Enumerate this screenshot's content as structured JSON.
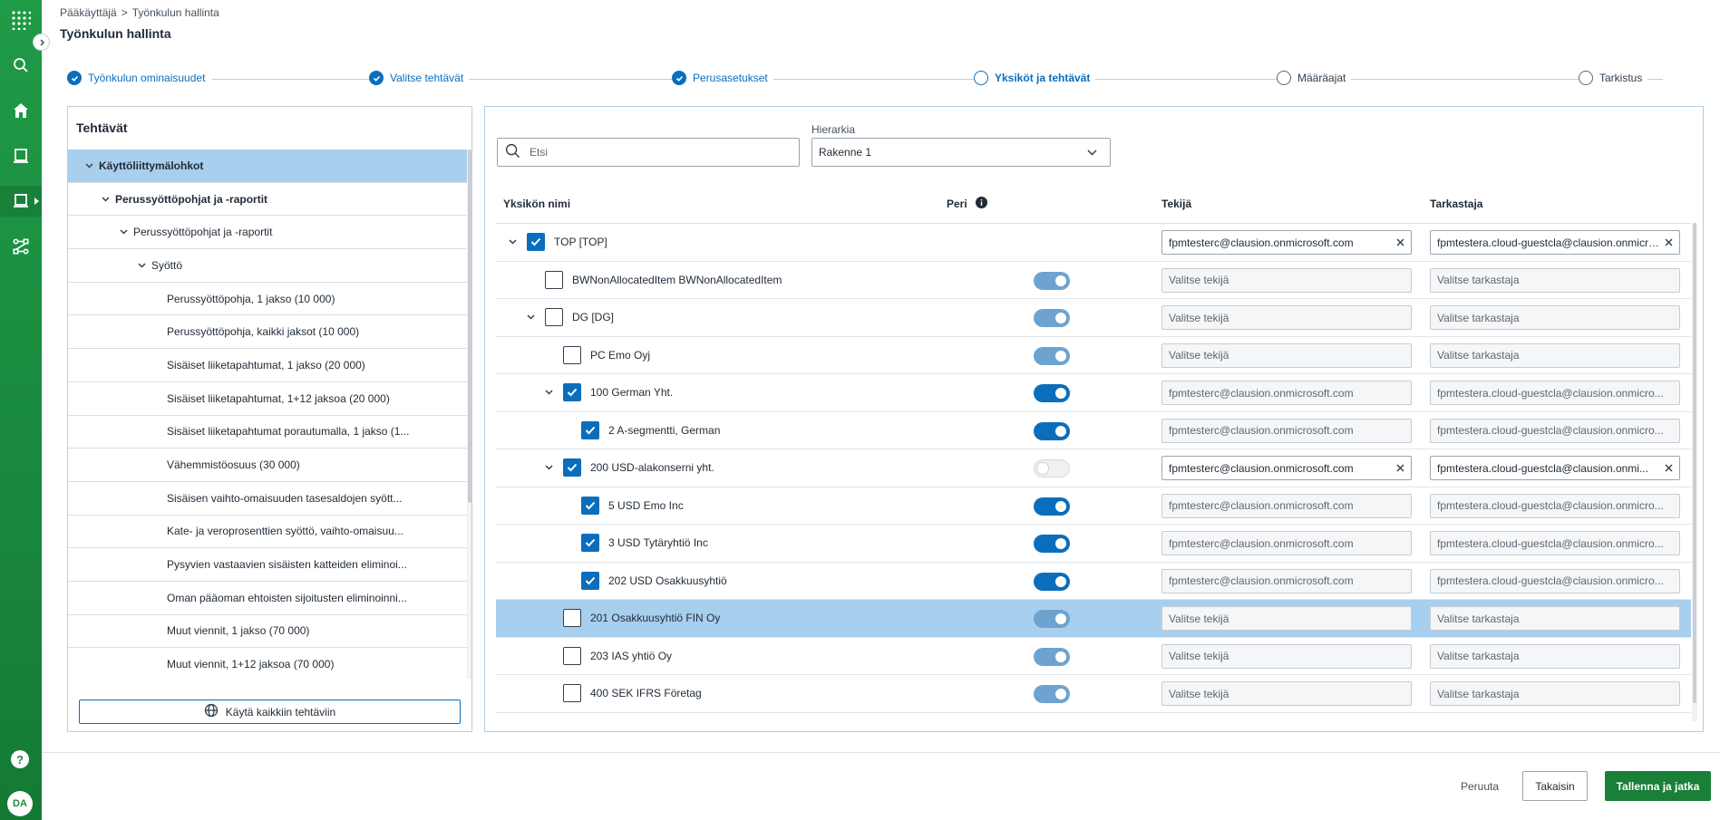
{
  "breadcrumb": {
    "root": "Pääkäyttäjä",
    "separator": ">",
    "current": "Työnkulun hallinta"
  },
  "page_title": "Työnkulun hallinta",
  "steps": [
    {
      "label": "Työnkulun ominaisuudet",
      "state": "done"
    },
    {
      "label": "Valitse tehtävät",
      "state": "done"
    },
    {
      "label": "Perusasetukset",
      "state": "done"
    },
    {
      "label": "Yksiköt ja tehtävät",
      "state": "current"
    },
    {
      "label": "Määräajat",
      "state": "todo"
    },
    {
      "label": "Tarkistus",
      "state": "todo"
    }
  ],
  "tasks_panel": {
    "title": "Tehtävät",
    "items": [
      {
        "label": "Käyttöliittymälohkot",
        "level": 0,
        "expanded": true,
        "bold": true,
        "selected": true
      },
      {
        "label": "Perussyöttöpohjat ja -raportit",
        "level": 1,
        "expanded": true,
        "bold": true
      },
      {
        "label": "Perussyöttöpohjat ja -raportit",
        "level": 2,
        "expanded": true
      },
      {
        "label": "Syöttö",
        "level": 3,
        "expanded": true
      },
      {
        "label": "Perussyöttöpohja, 1 jakso (10 000)",
        "level": 4
      },
      {
        "label": "Perussyöttöpohja, kaikki jaksot (10 000)",
        "level": 4
      },
      {
        "label": "Sisäiset liiketapahtumat, 1 jakso (20 000)",
        "level": 4
      },
      {
        "label": "Sisäiset liiketapahtumat, 1+12 jaksoa (20 000)",
        "level": 4
      },
      {
        "label": "Sisäiset liiketapahtumat porautumalla, 1 jakso (1...",
        "level": 4
      },
      {
        "label": "Vähemmistöosuus (30 000)",
        "level": 4
      },
      {
        "label": "Sisäisen vaihto-omaisuuden tasesaldojen syött...",
        "level": 4
      },
      {
        "label": "Kate- ja veroprosenttien syöttö, vaihto-omaisuu...",
        "level": 4
      },
      {
        "label": "Pysyvien vastaavien sisäisten katteiden eliminoi...",
        "level": 4
      },
      {
        "label": "Oman pääoman ehtoisten sijoitusten eliminoinni...",
        "level": 4
      },
      {
        "label": "Muut viennit, 1 jakso (70 000)",
        "level": 4
      },
      {
        "label": "Muut viennit, 1+12 jaksoa (70 000)",
        "level": 4
      }
    ],
    "apply_all_label": "Käytä kaikkiin tehtäviin"
  },
  "units_panel": {
    "search_placeholder": "Etsi",
    "hierarchy_label": "Hierarkia",
    "hierarchy_value": "Rakenne 1",
    "columns": {
      "name": "Yksikön nimi",
      "peri": "Peri",
      "tekija": "Tekijä",
      "tarkastaja": "Tarkastaja"
    },
    "rows": [
      {
        "name": "TOP [TOP]",
        "level": 0,
        "expander": true,
        "checked": true,
        "toggle": "hidden",
        "tekija": "fpmtesterc@clausion.onmicrosoft.com",
        "tarkastaja": "fpmtestera.cloud-guestcla@clausion.onmicrosoft.com",
        "fields_active": true,
        "clearable": true
      },
      {
        "name": "BWNonAllocatedItem BWNonAllocatedItem",
        "level": 1,
        "expander": false,
        "checked": false,
        "toggle": "dim",
        "tekija": "Valitse tekijä",
        "tarkastaja": "Valitse tarkastaja"
      },
      {
        "name": "DG [DG]",
        "level": 1,
        "expander": true,
        "checked": false,
        "toggle": "dim",
        "tekija": "Valitse tekijä",
        "tarkastaja": "Valitse tarkastaja"
      },
      {
        "name": "PC Emo Oyj",
        "level": 2,
        "expander": false,
        "checked": false,
        "toggle": "dim",
        "tekija": "Valitse tekijä",
        "tarkastaja": "Valitse tarkastaja"
      },
      {
        "name": "100 German Yht.",
        "level": 2,
        "expander": true,
        "checked": true,
        "toggle": "on",
        "tekija": "fpmtesterc@clausion.onmicrosoft.com",
        "tarkastaja": "fpmtestera.cloud-guestcla@clausion.onmicro..."
      },
      {
        "name": "2 A-segmentti, German",
        "level": 3,
        "expander": false,
        "checked": true,
        "toggle": "on",
        "tekija": "fpmtesterc@clausion.onmicrosoft.com",
        "tarkastaja": "fpmtestera.cloud-guestcla@clausion.onmicro..."
      },
      {
        "name": "200 USD-alakonserni yht.",
        "level": 2,
        "expander": true,
        "checked": true,
        "toggle": "off",
        "tekija": "fpmtesterc@clausion.onmicrosoft.com",
        "tarkastaja": "fpmtestera.cloud-guestcla@clausion.onmi...",
        "fields_active": true,
        "clearable": true
      },
      {
        "name": "5 USD Emo Inc",
        "level": 3,
        "expander": false,
        "checked": true,
        "toggle": "on",
        "tekija": "fpmtesterc@clausion.onmicrosoft.com",
        "tarkastaja": "fpmtestera.cloud-guestcla@clausion.onmicro..."
      },
      {
        "name": "3 USD Tytäryhtiö Inc",
        "level": 3,
        "expander": false,
        "checked": true,
        "toggle": "on",
        "tekija": "fpmtesterc@clausion.onmicrosoft.com",
        "tarkastaja": "fpmtestera.cloud-guestcla@clausion.onmicro..."
      },
      {
        "name": "202 USD Osakkuusyhtiö",
        "level": 3,
        "expander": false,
        "checked": true,
        "toggle": "on",
        "tekija": "fpmtesterc@clausion.onmicrosoft.com",
        "tarkastaja": "fpmtestera.cloud-guestcla@clausion.onmicro..."
      },
      {
        "name": "201 Osakkuusyhtiö FIN Oy",
        "level": 2,
        "expander": false,
        "checked": false,
        "toggle": "dim",
        "tekija": "Valitse tekijä",
        "tarkastaja": "Valitse tarkastaja",
        "selected": true
      },
      {
        "name": "203 IAS yhtiö Oy",
        "level": 2,
        "expander": false,
        "checked": false,
        "toggle": "dim",
        "tekija": "Valitse tekijä",
        "tarkastaja": "Valitse tarkastaja"
      },
      {
        "name": "400 SEK IFRS Företag",
        "level": 2,
        "expander": false,
        "checked": false,
        "toggle": "dim",
        "tekija": "Valitse tekijä",
        "tarkastaja": "Valitse tarkastaja"
      }
    ]
  },
  "footer": {
    "cancel": "Peruuta",
    "back": "Takaisin",
    "save": "Tallenna ja jatka"
  },
  "user": {
    "initials": "DA"
  },
  "colors": {
    "brand_green": "#1a8a3e",
    "accent_blue": "#0a6ebd",
    "selected_row": "#a9cfee",
    "primary_button": "#1a7f37"
  }
}
